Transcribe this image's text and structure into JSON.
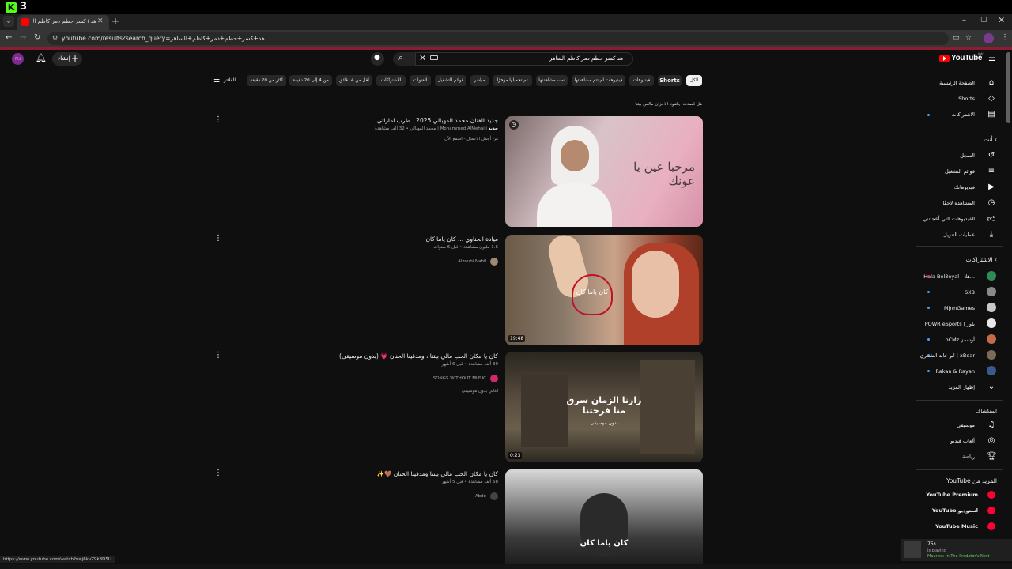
{
  "os": {
    "app_badge": "K",
    "badge_count": "3",
    "clock": ""
  },
  "browser": {
    "tab_title": "هد+كسر حطم دمر كاظم الساهر",
    "url": "youtube.com/results?search_query=هد+كسر+حطم+دمر+كاظم+الساهر",
    "status_url": "https://www.youtube.com/watch?v=j6kvZ9k8D5U"
  },
  "header": {
    "create_label": "إنشاء",
    "search_value": "هد كسر حطم دمر كاظم الساهر",
    "logo_text": "YouTube",
    "country": "KW"
  },
  "filters": {
    "label": "الفلاتر",
    "chips": [
      {
        "label": "الكل",
        "active": true
      },
      {
        "label": "Shorts",
        "active": false
      },
      {
        "label": "فيديوهات",
        "active": false
      },
      {
        "label": "فيديوهات لم تتم مشاهدتها",
        "active": false
      },
      {
        "label": "تمت مشاهدتها",
        "active": false
      },
      {
        "label": "تم تحميلها مؤخرًا",
        "active": false
      },
      {
        "label": "مباشر",
        "active": false
      },
      {
        "label": "قوائم التشغيل",
        "active": false
      },
      {
        "label": "القنوات",
        "active": false
      },
      {
        "label": "الاشتراكات",
        "active": false
      },
      {
        "label": "أقل من 4 دقائق",
        "active": false
      },
      {
        "label": "من 4 إلى 20 دقيقة",
        "active": false
      },
      {
        "label": "أكثر من 20 دقيقة",
        "active": false
      }
    ]
  },
  "did_you_mean": "هل قصدت: يكفونا الاحزان مالس بيتنا",
  "results": [
    {
      "title": "جديد الفنان محمد المهيالي 2025 | طرب اماراتي",
      "channel": "Mohammed AlMehaili | محمد المهيالي",
      "meta1": "32 ألف مشاهدة",
      "meta2": "من أجمل الاعمال - اسمع الآن",
      "duration": "",
      "new_badge": "جديد",
      "thumb_text": "مرحبا عين يا عونك"
    },
    {
      "title": "ميادة الحناوي ... كان ياما كان",
      "channel": "Alzoubi Nabil",
      "meta1": "1.6 مليون مشاهدة • قبل 6 سنوات",
      "meta2": "",
      "duration": "19:48",
      "thumb_text": "كان ياما كان"
    },
    {
      "title": "كان يا مكان الحب مالي بيتنا ، ومدفينا الحنان 💗 (بدون موسيقى)",
      "channel": "SONGS WITHOUT MUSIC",
      "meta1": "30 ألف مشاهدة • قبل 6 أشهر",
      "meta2": "اغاني بدون موسيقى",
      "duration": "0:23",
      "thumb_text": "زارنا الزمان سرق منا فرحتنا",
      "thumb_sub": "بدون موسيقى"
    },
    {
      "title": "كان يا مكان الحب مالي بيتنا ومدفينا الحنان 🤎✨",
      "channel": "Abdo",
      "meta1": "68 ألف مشاهدة • قبل 5 أشهر",
      "meta2": "",
      "duration": "",
      "thumb_text": "كان ياما كان"
    }
  ],
  "sidebar": {
    "main": [
      {
        "label": "الصفحة الرئيسية",
        "icon": "home-icon"
      },
      {
        "label": "Shorts",
        "icon": "shorts-icon"
      },
      {
        "label": "الاشتراكات",
        "icon": "subscriptions-icon"
      }
    ],
    "you_header": "أنت",
    "you": [
      {
        "label": "السجل",
        "icon": "history-icon"
      },
      {
        "label": "قوائم التشغيل",
        "icon": "playlists-icon"
      },
      {
        "label": "فيديوهاتك",
        "icon": "your-videos-icon"
      },
      {
        "label": "المشاهدة لاحقًا",
        "icon": "watch-later-icon"
      },
      {
        "label": "الفيديوهات التي أعجبتني",
        "icon": "liked-icon"
      },
      {
        "label": "عمليات التنزيل",
        "icon": "downloads-icon"
      }
    ],
    "subs_header": "الاشتراكات",
    "subs": [
      {
        "label": "Hala Bel3eyal - هلا...",
        "color": "#2e8b57",
        "dot": false,
        "red": true
      },
      {
        "label": "SXB",
        "color": "#8a8a8a",
        "dot": true
      },
      {
        "label": "MjrmGames",
        "color": "#c8c8c8",
        "dot": true
      },
      {
        "label": "POWR eSports | باور",
        "color": "#e8e8e8",
        "dot": false
      },
      {
        "label": "oCMz أوسمز",
        "color": "#c26a4a",
        "dot": true
      },
      {
        "label": "ابو عابد الشمري | xBear",
        "color": "#7a6a5a",
        "dot": true
      },
      {
        "label": "Rakan & Rayan",
        "color": "#3a5a8a",
        "dot": true
      }
    ],
    "show_more": "إظهار المزيد",
    "explore_header": "استكشاف",
    "explore": [
      {
        "label": "موسيقى",
        "icon": "music-icon"
      },
      {
        "label": "ألعاب فيديو",
        "icon": "gaming-icon"
      },
      {
        "label": "رياضة",
        "icon": "sports-icon"
      }
    ],
    "more_header": "المزيد من YouTube",
    "more": [
      {
        "label": "YouTube Premium"
      },
      {
        "label": "استوديو YouTube"
      },
      {
        "label": "YouTube Music"
      }
    ]
  },
  "miniplayer": {
    "line1": "75s",
    "line2": "is playing",
    "line3": "Maurice: In The Predator's Nest"
  }
}
